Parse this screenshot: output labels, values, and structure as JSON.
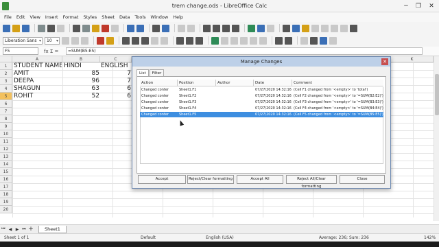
{
  "window": {
    "title": "trem change.ods - LibreOffice Calc"
  },
  "menu": [
    "File",
    "Edit",
    "View",
    "Insert",
    "Format",
    "Styles",
    "Sheet",
    "Data",
    "Tools",
    "Window",
    "Help"
  ],
  "toolbar": {
    "font_name": "Liberation Sans",
    "font_size": "10"
  },
  "formula_bar": {
    "cell_ref": "F5",
    "fx_symbols": "fx  Σ  =",
    "formula": "=SUM(B5:E5)"
  },
  "columns": [
    "A",
    "B",
    "C",
    "K"
  ],
  "rows": [
    "1",
    "2",
    "3",
    "4",
    "5",
    "6",
    "7",
    "8",
    "9",
    "10",
    "11",
    "12",
    "13",
    "14",
    "15",
    "16",
    "17",
    "18",
    "19",
    "20"
  ],
  "cells": {
    "a1": "STUDENT NAME",
    "b1": "HINDI",
    "c1": "ENGLISH",
    "a2": "AMIT",
    "b2": "85",
    "c2": "7",
    "a3": "DEEPA",
    "b3": "96",
    "c3": "7",
    "a4": "SHAGUN",
    "b4": "63",
    "c4": "6",
    "a5": "ROHIT",
    "b5": "52",
    "c5": "6"
  },
  "sheet_tab": "Sheet1",
  "status": {
    "sheet": "Sheet 1 of 1",
    "style": "Default",
    "language": "English (USA)",
    "summary": "Average: 236; Sum: 236",
    "zoom": "142%"
  },
  "dialog": {
    "title": "Manage Changes",
    "tabs": [
      "List",
      "Filter"
    ],
    "headers": [
      "Action",
      "Position",
      "Author",
      "Date",
      "Comment"
    ],
    "rows": [
      {
        "action": "Changed conter",
        "position": "Sheet1.F1",
        "author": "",
        "date": "07/27/2020 14:32:16",
        "comment": "(Cell F1 changed from '<empty>' to 'total')"
      },
      {
        "action": "Changed conter",
        "position": "Sheet1.F2",
        "author": "",
        "date": "07/27/2020 14:32:16",
        "comment": "(Cell F2 changed from '<empty>' to '=SUM(B2:E2)')"
      },
      {
        "action": "Changed conter",
        "position": "Sheet1.F3",
        "author": "",
        "date": "07/27/2020 14:32:16",
        "comment": "(Cell F3 changed from '<empty>' to '=SUM(B3:E3)')"
      },
      {
        "action": "Changed conter",
        "position": "Sheet1.F4",
        "author": "",
        "date": "07/27/2020 14:32:16",
        "comment": "(Cell F4 changed from '<empty>' to '=SUM(B4:E4)')"
      },
      {
        "action": "Changed conter",
        "position": "Sheet1.F5",
        "author": "",
        "date": "07/27/2020 14:32:16",
        "comment": "(Cell F5 changed from '<empty>' to '=SUM(B5:E5)')"
      }
    ],
    "buttons": {
      "accept": "Accept",
      "reject": "Reject/Clear formatting",
      "accept_all": "Accept All",
      "reject_all": "Reject All/Clear formatting",
      "close": "Close"
    }
  },
  "colors": {
    "selection": "#3d8ee0",
    "row_highlight": "#f3c15e",
    "dialog_title": "#bdd0e8"
  }
}
